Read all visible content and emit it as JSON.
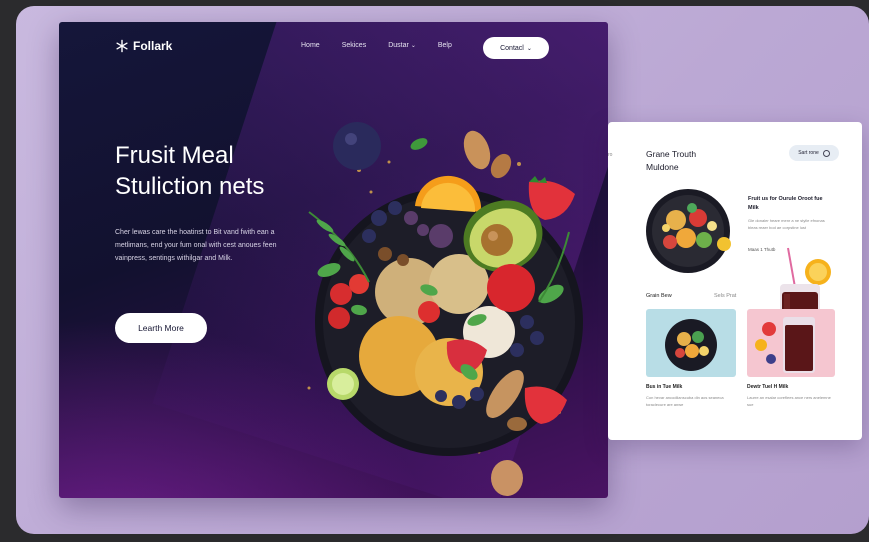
{
  "hero": {
    "logo_text": "Follark",
    "nav": [
      "Home",
      "Sekices",
      "Dustar",
      "Belp"
    ],
    "contact_label": "Contacl",
    "headline_line1": "Frusit Meal",
    "headline_line2": "Stuliction nets",
    "description": "Cher lewas care the hoatinst to Bit vand fwith ean a metlimans, end your fum onal with cest anoues feen vainpress, sentings withilgar and Milk.",
    "cta_label": "Learth More"
  },
  "side": {
    "edge_label": "ro",
    "title": "Grane Trouth Muldone",
    "start_label": "Sart rone",
    "card_title": "Fruit us for Ourule Oroot fue Milk",
    "card_text": "Gle donaler heare menr a ne styile efnonas bleas reaer bod ae corpstine lust",
    "card_meta": "Maas  1 Thutb",
    "section_left": "Grain Bew",
    "section_right": "Sels Prat",
    "thumb1_title": "Bus in Tue Milk",
    "thumb1_text": "Con hevar ancodlianscuba din aos seaneca toraclecure are anwe",
    "thumb2_title": "Dewtr Tuel H Milk",
    "thumb2_text": "Laurre an esalar coreflees ance ners anelemne sue"
  },
  "colors": {
    "hero_dark": "#13132f",
    "hero_purple": "#4a1363",
    "stage_lilac": "#bba8d4",
    "button_white": "#ffffff"
  },
  "icons": [
    "snowflake-logo-icon",
    "chevron-down-icon",
    "toggle-icon"
  ]
}
